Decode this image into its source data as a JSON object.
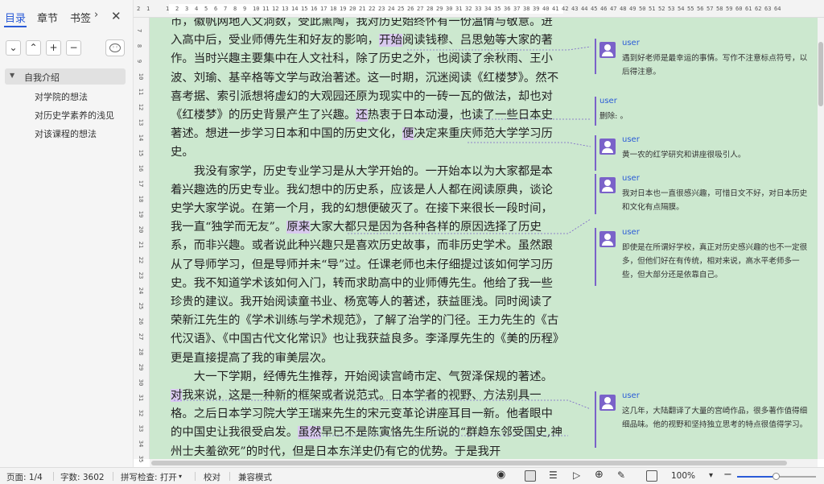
{
  "sidebar": {
    "tabs": [
      "目录",
      "章节",
      "书签"
    ],
    "toc_root": "自我介绍",
    "toc_children": [
      "对学院的想法",
      "对历史学素养的浅见",
      "对该课程的想法"
    ]
  },
  "ruler": {
    "h": [
      "2",
      "1",
      "",
      "1",
      "2",
      "3",
      "4",
      "5",
      "6",
      "7",
      "8",
      "9",
      "10",
      "11",
      "12",
      "13",
      "14",
      "15",
      "16",
      "17",
      "18",
      "19",
      "20",
      "21",
      "22",
      "23",
      "24",
      "25",
      "26",
      "27",
      "28",
      "29",
      "30",
      "31",
      "32",
      "33",
      "34",
      "35",
      "36",
      "37",
      "38",
      "39",
      "40",
      "41",
      "42",
      "43",
      "44",
      "45",
      "46",
      "47",
      "48",
      "49",
      "50",
      "51",
      "52",
      "53",
      "54",
      "55",
      "56",
      "57",
      "58",
      "59",
      "60",
      "61",
      "62",
      "63",
      "64"
    ],
    "v": [
      "7",
      "8",
      "9",
      "10",
      "11",
      "12",
      "13",
      "14",
      "15",
      "16",
      "17",
      "18",
      "19",
      "20",
      "21",
      "22",
      "23",
      "24",
      "25",
      "26",
      "27",
      "28",
      "29",
      "30",
      "31",
      "32",
      "33",
      "34",
      "35"
    ]
  },
  "document": {
    "paragraphs": [
      {
        "indent": false,
        "segments": [
          {
            "t": "市，徽帆网地人文洞数，受此熏陶，我对历史始终怀有一份温情与敬意。进入高中后，受业师傅先生和好友的影响，"
          },
          {
            "t": "开始",
            "hl": true
          },
          {
            "t": "阅读钱穆、吕思勉等大家的著作。当时兴趣主要集中在人文社科，除了历史之外，也阅读了余秋雨、王小波、刘瑜、基辛格等文学与政治著述。这一时期，沉迷阅读《红楼梦》。然不喜考据、索引派想将虚幻的大观园还原为现实中的一砖一瓦的做法，却也对《红楼梦》的历史背景产生了兴趣。"
          },
          {
            "t": "还",
            "hl": true
          },
          {
            "t": "热衷于日本动漫，也读了一些日本史著述。想进一步学习日本和中国的历史文化，"
          },
          {
            "t": "便",
            "hl": true
          },
          {
            "t": "决定来重庆师范大学学习历史。"
          }
        ]
      },
      {
        "indent": true,
        "segments": [
          {
            "t": "我没有家学，历史专业学习是从大学开始的。一开始本以为大家都是本着兴趣选的历史专业。我幻想中的历史系，应该是人人都在阅读原典，谈论史学大家学说。在第一个月，我的幻想便破灭了。在接下来很长一段时间，我一直“独学而无友”。"
          },
          {
            "t": "原来",
            "hl": true
          },
          {
            "t": "大家大都只是因为各种各样的原因选择了历史系，而非兴趣。或者说此种兴趣只是喜欢历史故事，而非历史学术。虽然跟从了导师学习，但是导师并未“导”过。任课老师也未仔细提过该如何学习历史。我不知道学术该如何入门，转而求助高中的业师傅先生。他给了我一些珍贵的建议。我开始阅读童书业、杨宽等人的著述，获益匪浅。同时阅读了荣新江先生的《学术训练与学术规范》，了解了治学的门径。王力先生的《古代汉语》、《中国古代文化常识》也让我获益良多。李泽厚先生的《美的历程》更是直接提高了我的审美层次。"
          }
        ]
      },
      {
        "indent": true,
        "segments": [
          {
            "t": "大一下学期，经傅先生推荐，开始阅读宫崎市定、气贺泽保规的著述。"
          },
          {
            "t": "对",
            "hl": true
          },
          {
            "t": "我来说，这是一种新的框架或者说范式。日本学者的视野、方法别具一格。之后日本学习院大学王瑞来先生的宋元变革论讲座耳目一新。他者眼中的中国史让我很受启发。"
          },
          {
            "t": "虽然",
            "hl": true
          },
          {
            "t": "早已不是陈寅恪先生所说的“群趋东邻受国史,神州士夫羞欲死”的时代，但是日本东洋史仍有它的优势。于是我开"
          }
        ]
      }
    ]
  },
  "comments": [
    {
      "user": "user",
      "text": "遇到好老师是最幸运的事情。写作不注意标点符号，以后得注意。",
      "avatar": true
    },
    {
      "user": "user",
      "text": "删除: 。",
      "avatar": false
    },
    {
      "user": "user",
      "text": "黄一农的红学研究和讲座很吸引人。",
      "avatar": true
    },
    {
      "user": "user",
      "text": "我对日本也一直很感兴趣，可惜日文不好，对日本历史和文化有点隔膜。",
      "avatar": true
    },
    {
      "user": "user",
      "text": "即使是在所谓好学校，真正对历史感兴趣的也不一定很多，但他们好在有传统，相对来说，高水平老师多一些，但大部分还是依靠自己。",
      "avatar": true
    },
    {
      "user": "user",
      "text": "这几年，大陆翻译了大量的宫崎作品，很多著作值得细细品味。他的视野和坚持独立思考的特点很值得学习。",
      "avatar": true
    }
  ],
  "status": {
    "page": "页面: 1/4",
    "words": "字数: 3602",
    "spell": "拼写检查: 打开",
    "proof": "校对",
    "compat": "兼容模式",
    "zoom": "100%",
    "zoom_fraction": 0.5
  },
  "colors": {
    "doc_bg": "#cce8cf",
    "accent": "#2a5bd7",
    "comment_accent": "#7a62c9",
    "highlight": "#d8c9ee"
  }
}
